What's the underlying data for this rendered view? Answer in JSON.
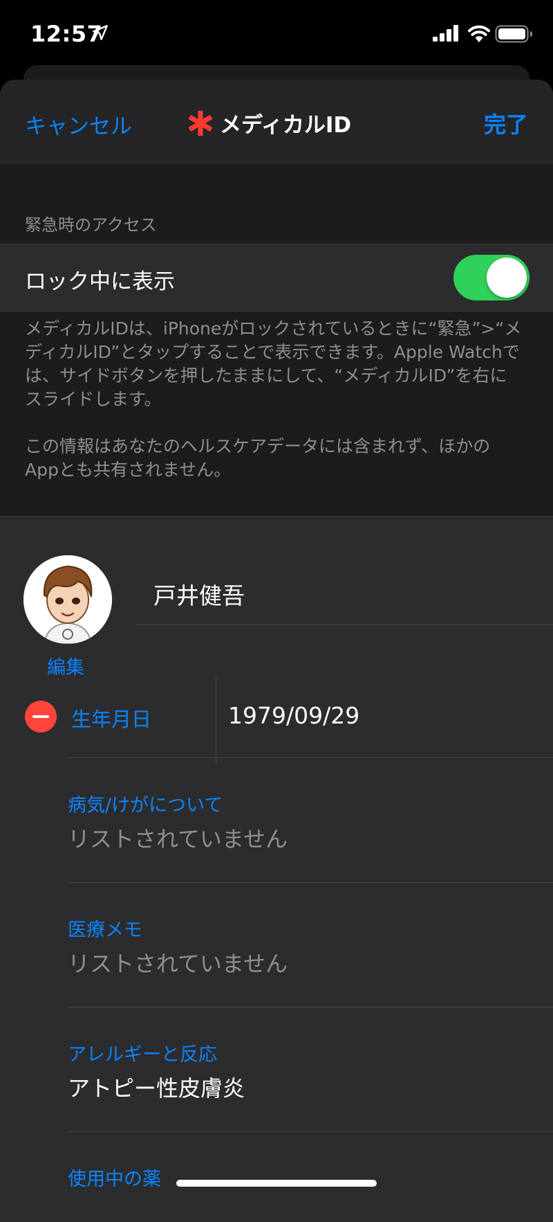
{
  "status_bar": {
    "time": "12:57",
    "icons": [
      "location-arrow-icon",
      "cellular-signal-icon",
      "wifi-icon",
      "battery-icon"
    ]
  },
  "nav": {
    "cancel_label": "キャンセル",
    "title": "メディカルID",
    "done_label": "完了",
    "title_icon": "medical-asterisk-icon",
    "accent_color": "#0a84ff",
    "asterisk_color": "#ff3b30"
  },
  "emergency_access": {
    "section_header": "緊急時のアクセス",
    "show_when_locked_label": "ロック中に表示",
    "show_when_locked": true,
    "toggle_color": "#30d158",
    "note_paragraph_1": "メディカルIDは、iPhoneがロックされているときに“緊急”>“メディカルID”とタップすることで表示できます。Apple Watchでは、サイドボタンを押したままにして、“メディカルID”を右にスライドします。",
    "note_paragraph_2": "この情報はあなたのヘルスケアデータには含まれず、ほかのAppとも共有されません。"
  },
  "profile": {
    "edit_label": "編集",
    "name": "戸井健吾",
    "birthdate_label": "生年月日",
    "birthdate": "1979/09/29",
    "fields": [
      {
        "label": "病気/けがについて",
        "value": "リストされていません",
        "placeholder": true
      },
      {
        "label": "医療メモ",
        "value": "リストされていません",
        "placeholder": true
      },
      {
        "label": "アレルギーと反応",
        "value": "アトピー性皮膚炎",
        "placeholder": false
      },
      {
        "label": "使用中の薬",
        "value": "",
        "placeholder": true
      }
    ]
  }
}
